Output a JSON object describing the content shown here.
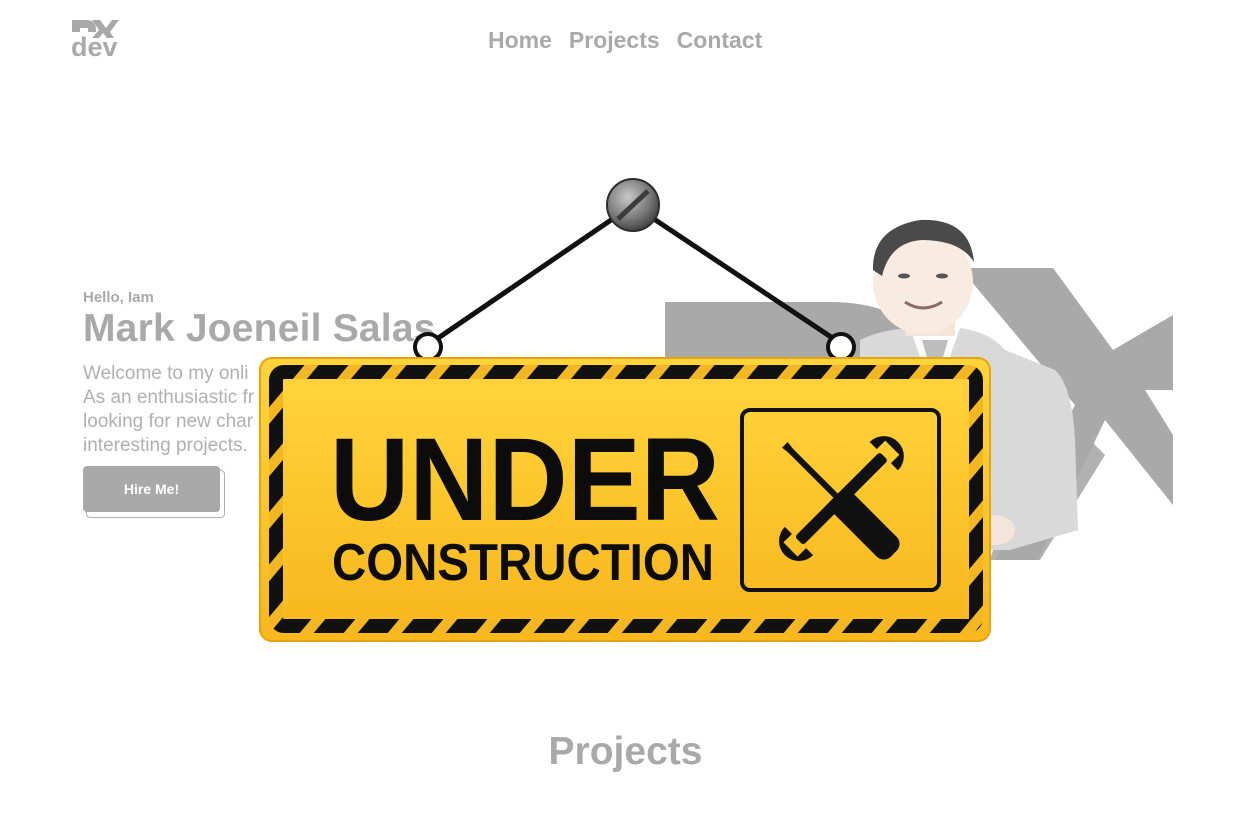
{
  "brand": {
    "logo_text": "dev",
    "logo_mark_icon": "dx-logo-icon"
  },
  "nav": {
    "items": [
      {
        "label": "Home"
      },
      {
        "label": "Projects"
      },
      {
        "label": "Contact"
      }
    ]
  },
  "hero": {
    "greeting": "Hello, Iam",
    "name": "Mark Joeneil Salas",
    "description_lines": [
      "Welcome to my onli",
      "As an enthusiastic fr",
      "looking for new char",
      "interesting projects."
    ],
    "cta_label": "Hire Me!",
    "portrait_icon": "portrait-photo",
    "backdrop_icon": "dx-backdrop-icon"
  },
  "overlay": {
    "sign_line_1": "UNDER",
    "sign_line_2": "CONSTRUCTION",
    "sign_icon": "wrench-screwdriver-icon",
    "colors": {
      "sign_yellow": "#FFC72C",
      "sign_stripe": "#111111",
      "text_gray": "#A9A9A9"
    }
  },
  "projects": {
    "title": "Projects"
  }
}
